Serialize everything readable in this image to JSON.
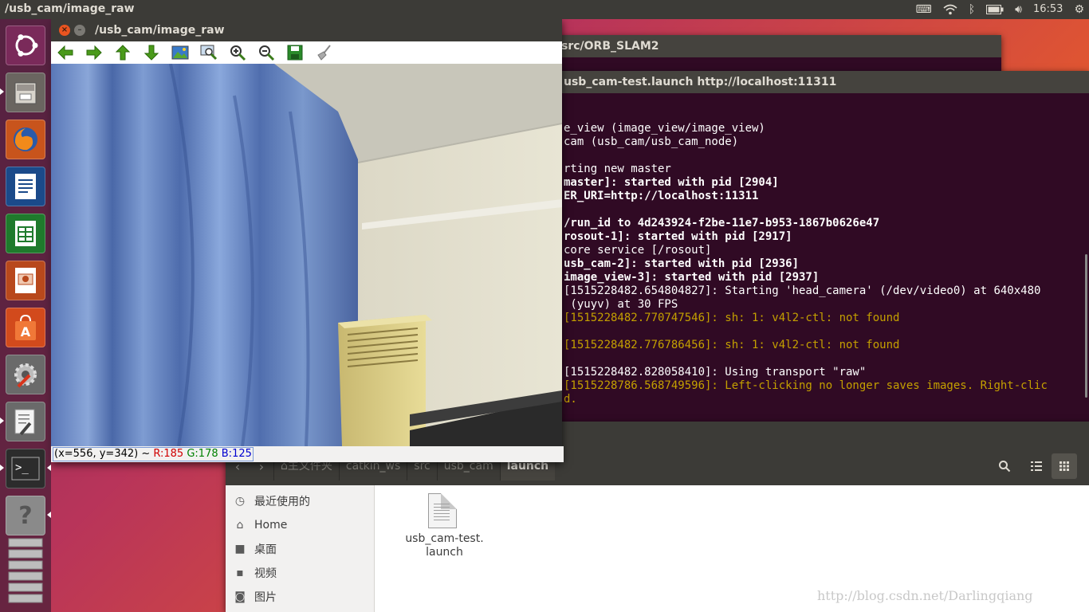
{
  "top_panel": {
    "title": "/usb_cam/image_raw",
    "clock": "16:53"
  },
  "launcher": {
    "items": [
      {
        "name": "ubuntu-dash",
        "color": "#7a2a5a"
      },
      {
        "name": "files",
        "color": "#5a5550"
      },
      {
        "name": "firefox",
        "color": "#c8541c"
      },
      {
        "name": "libreoffice-writer",
        "color": "#1b4a8a"
      },
      {
        "name": "libreoffice-calc",
        "color": "#1f7a2c"
      },
      {
        "name": "libreoffice-impress",
        "color": "#b8481c"
      },
      {
        "name": "ubuntu-software",
        "color": "#d24a1c"
      },
      {
        "name": "system-settings",
        "color": "#6a6a6a"
      },
      {
        "name": "text-editor",
        "color": "#6a6a6a"
      },
      {
        "name": "terminal",
        "color": "#2c2c2c"
      },
      {
        "name": "help",
        "color": "#8a8a8a"
      }
    ]
  },
  "orb_window": {
    "title": "src/ORB_SLAM2"
  },
  "terminal": {
    "title": "usb_cam-test.launch http://localhost:11311",
    "lines": [
      {
        "text": "e_view (image_view/image_view)",
        "style": "normal"
      },
      {
        "text": "cam (usb_cam/usb_cam_node)",
        "style": "normal"
      },
      {
        "text": "",
        "style": "normal"
      },
      {
        "text": "rting new master",
        "style": "normal"
      },
      {
        "text": "master]: started with pid [2904]",
        "style": "bold"
      },
      {
        "text": "ER_URI=http://localhost:11311",
        "style": "bold"
      },
      {
        "text": "",
        "style": "normal"
      },
      {
        "text": "/run_id to 4d243924-f2be-11e7-b953-1867b0626e47",
        "style": "bold"
      },
      {
        "text": "rosout-1]: started with pid [2917]",
        "style": "bold"
      },
      {
        "text": "core service [/rosout]",
        "style": "normal"
      },
      {
        "text": "usb_cam-2]: started with pid [2936]",
        "style": "bold"
      },
      {
        "text": "image_view-3]: started with pid [2937]",
        "style": "bold"
      },
      {
        "text": "[1515228482.654804827]: Starting 'head_camera' (/dev/video0) at 640x480",
        "style": "normal"
      },
      {
        "text": " (yuyv) at 30 FPS",
        "style": "normal"
      },
      {
        "text": "[1515228482.770747546]: sh: 1: v4l2-ctl: not found",
        "style": "warn"
      },
      {
        "text": "",
        "style": "normal"
      },
      {
        "text": "[1515228482.776786456]: sh: 1: v4l2-ctl: not found",
        "style": "warn"
      },
      {
        "text": "",
        "style": "normal"
      },
      {
        "text": "[1515228482.828058410]: Using transport \"raw\"",
        "style": "normal"
      },
      {
        "text": "[1515228786.568749596]: Left-clicking no longer saves images. Right-clic",
        "style": "warn"
      },
      {
        "text": "d.",
        "style": "warn"
      }
    ]
  },
  "file_manager": {
    "breadcrumbs": [
      "主文件夹",
      "catkin_ws",
      "src",
      "usb_cam",
      "launch"
    ],
    "sidebar": [
      {
        "icon": "clock-icon",
        "label": "最近使用的"
      },
      {
        "icon": "home-icon",
        "label": "Home"
      },
      {
        "icon": "folder-icon",
        "label": "桌面"
      },
      {
        "icon": "video-icon",
        "label": "视频"
      },
      {
        "icon": "camera-icon",
        "label": "图片"
      }
    ],
    "file": {
      "name_line1": "usb_cam-test.",
      "name_line2": "launch"
    }
  },
  "image_view": {
    "title": "/usb_cam/image_raw",
    "toolbar": [
      "back-arrow-icon",
      "forward-arrow-icon",
      "up-arrow-icon",
      "down-arrow-icon",
      "image-icon",
      "zoom-fit-icon",
      "zoom-in-icon",
      "zoom-out-icon",
      "save-icon",
      "clear-icon"
    ],
    "status": {
      "coords": "(x=556, y=342) ~",
      "r": "R:185",
      "g": "G:178",
      "b": "B:125"
    }
  },
  "watermark": "http://blog.csdn.net/Darlingqiang"
}
